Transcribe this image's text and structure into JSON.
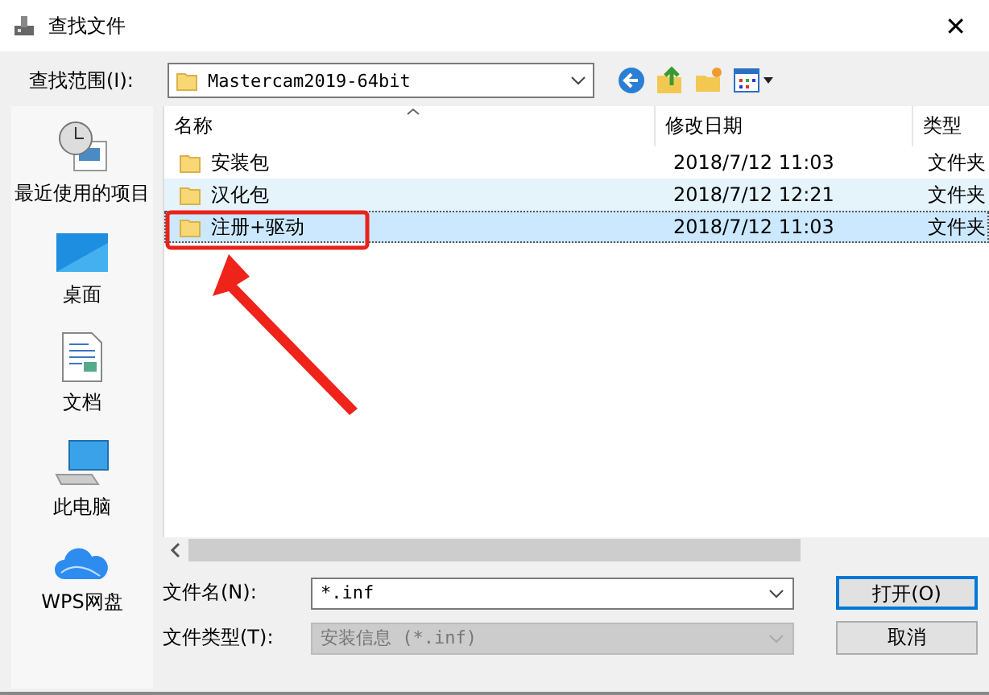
{
  "window": {
    "title": "查找文件",
    "close": "✕"
  },
  "look_in": {
    "label": "查找范围(I):",
    "value": "Mastercam2019-64bit"
  },
  "sidebar": {
    "items": [
      {
        "kind": "recent",
        "label": "最近使用的项目"
      },
      {
        "kind": "desktop",
        "label": "桌面"
      },
      {
        "kind": "documents",
        "label": "文档"
      },
      {
        "kind": "computer",
        "label": "此电脑"
      },
      {
        "kind": "cloud",
        "label": "WPS网盘"
      }
    ]
  },
  "table": {
    "columns": [
      "名称",
      "修改日期",
      "类型"
    ],
    "rows": [
      {
        "name": "安装包",
        "date": "2018/7/12 11:03",
        "type": "文件夹",
        "selected": false,
        "hovered": false
      },
      {
        "name": "汉化包",
        "date": "2018/7/12 12:21",
        "type": "文件夹",
        "selected": false,
        "hovered": true
      },
      {
        "name": "注册+驱动",
        "date": "2018/7/12 11:03",
        "type": "文件夹",
        "selected": true,
        "hovered": false
      }
    ]
  },
  "file_name": {
    "label": "文件名(N):",
    "value": "*.inf"
  },
  "file_type": {
    "label": "文件类型(T):",
    "value": "安装信息 (*.inf)",
    "disabled": true
  },
  "buttons": [
    {
      "label": "打开(O)",
      "default": true
    },
    {
      "label": "取消",
      "default": false
    }
  ]
}
